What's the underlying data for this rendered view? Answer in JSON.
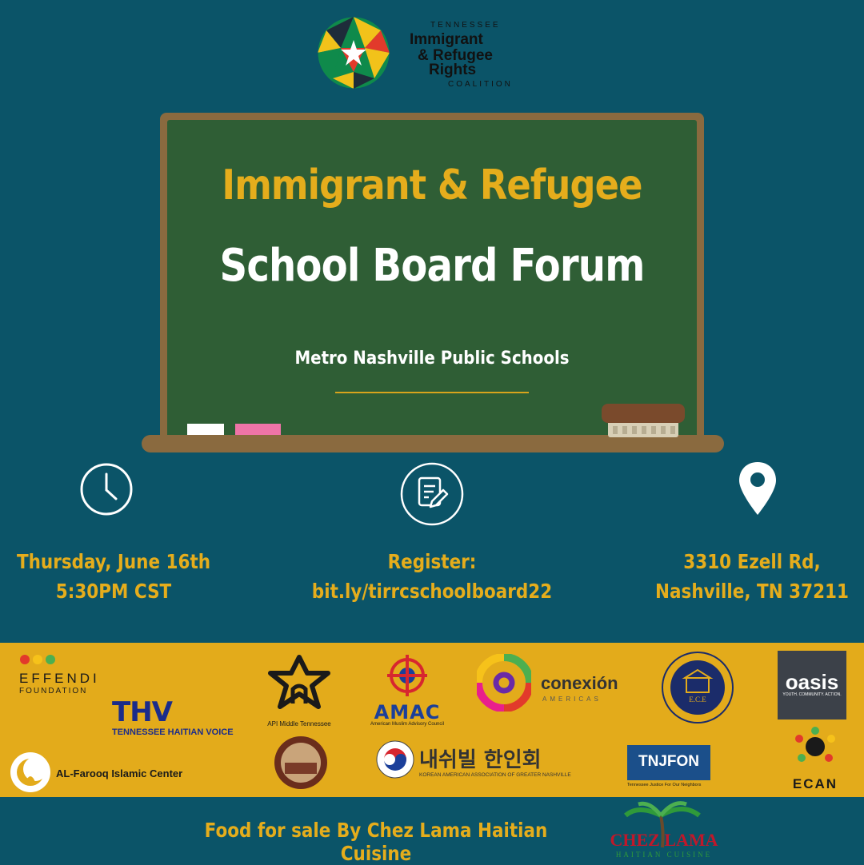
{
  "header": {
    "logo": {
      "line_top": "TENNESSEE",
      "line_1": "Immigrant",
      "line_2": "& Refugee",
      "line_3": "Rights",
      "line_bottom": "COALITION"
    }
  },
  "board": {
    "title_line_1": "Immigrant & Refugee",
    "title_line_2": "School Board Forum",
    "subtitle": "Metro Nashville Public Schools"
  },
  "info": {
    "date_line_1": "Thursday, June 16th",
    "date_line_2": "5:30PM CST",
    "register_line_1": "Register:",
    "register_line_2": "bit.ly/tirrcschoolboard22",
    "address_line_1": "3310 Ezell Rd,",
    "address_line_2": "Nashville, TN 37211",
    "icons": [
      "clock-icon",
      "register-form-icon",
      "location-pin-icon"
    ]
  },
  "sponsors": {
    "effendi": {
      "name": "EFFENDI",
      "sub": "FOUNDATION"
    },
    "thv": {
      "name": "THV",
      "sub": "TENNESSEE HAITIAN VOICE"
    },
    "api": {
      "name": "API Middle Tennessee"
    },
    "amac": {
      "name": "AMAC",
      "sub": "American Muslim Advisory Council"
    },
    "conexion": {
      "name": "conexión",
      "sub": "AMERICAS"
    },
    "ece": {
      "name": "E.C.E"
    },
    "oasis": {
      "name": "oasis",
      "sub": "YOUTH. COMMUNITY. ACTION."
    },
    "alfarooq": {
      "name": "AL-Farooq Islamic Center"
    },
    "korean": {
      "name": "내쉬빌 한인회",
      "sub": "KOREAN AMERICAN ASSOCIATION OF GREATER NASHVILLE"
    },
    "tnjfon": {
      "name": "TNJFON",
      "sub": "Tennessee Justice For Our Neighbors"
    },
    "ecan": {
      "name": "ECAN"
    }
  },
  "footer": {
    "food_text": "Food for sale By Chez Lama Haitian Cuisine",
    "chez_name": "CHEZ LAMA",
    "chez_sub": "HAITIAN CUISINE"
  },
  "colors": {
    "background": "#0b5468",
    "board_green": "#2f5e35",
    "board_frame": "#8a6a3f",
    "gold": "#e5ad1c",
    "sponsor_band": "#e3ab1b"
  }
}
